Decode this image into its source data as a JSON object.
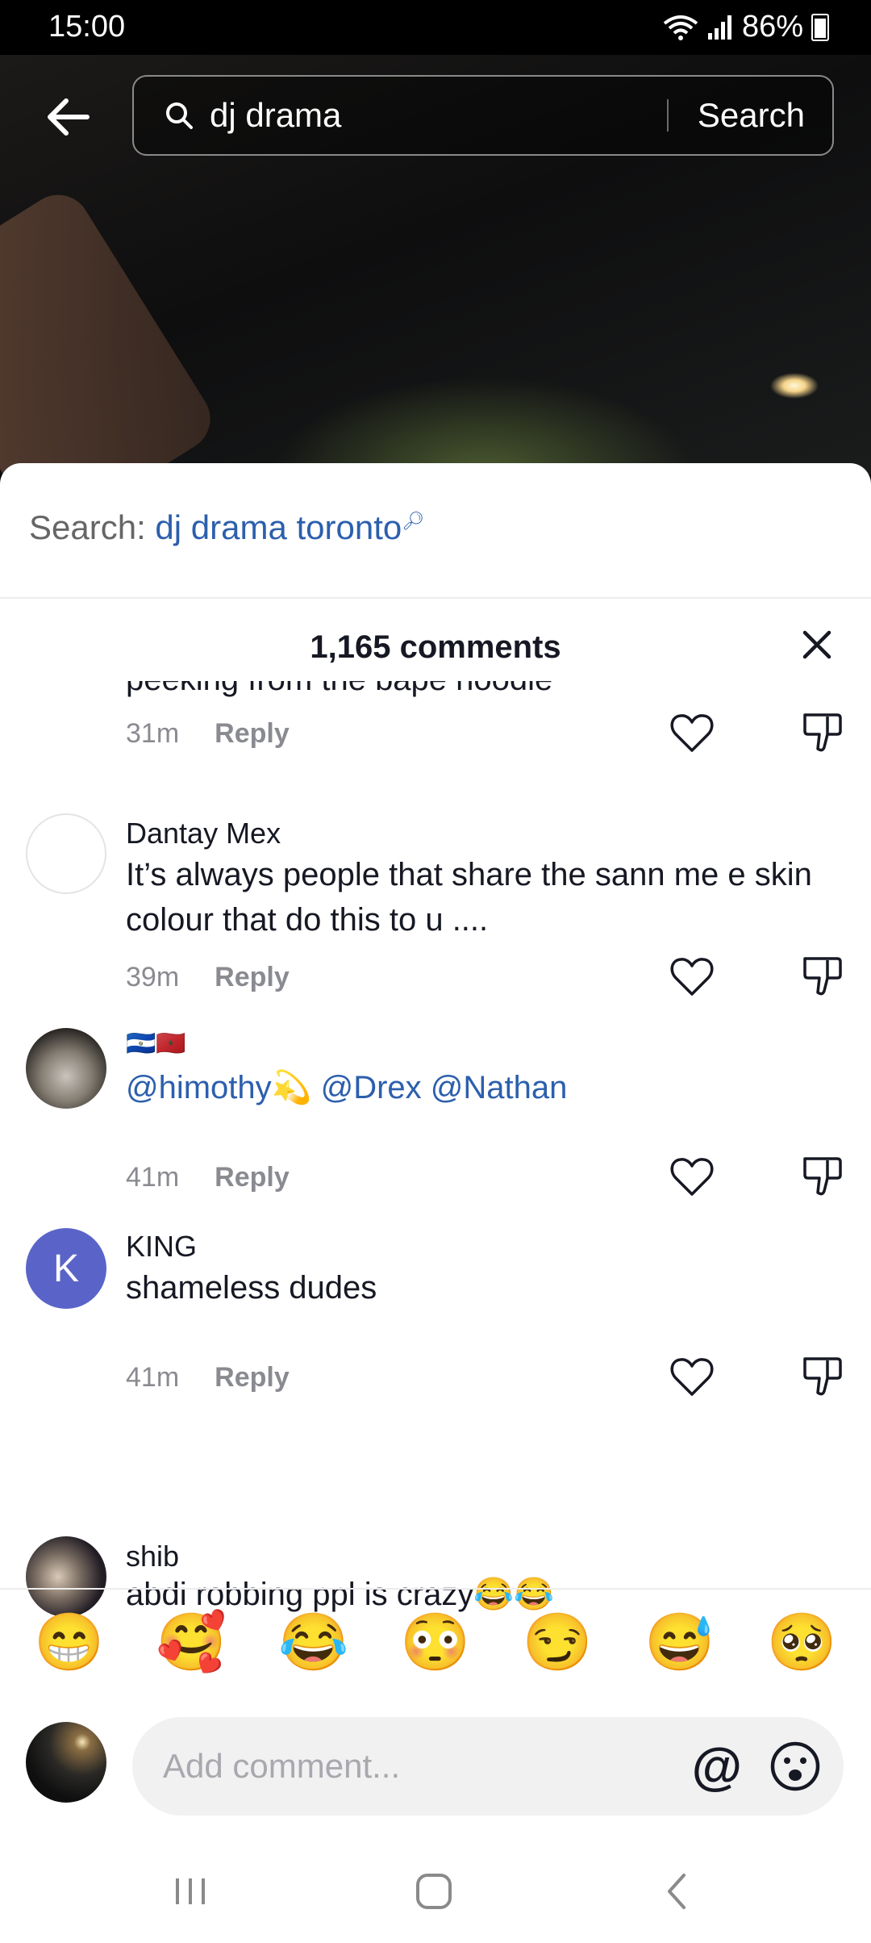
{
  "status_bar": {
    "time": "15:00",
    "battery": "86%"
  },
  "search": {
    "query": "dj drama",
    "button": "Search"
  },
  "suggestion": {
    "prefix": "Search:",
    "term": "dj drama toronto"
  },
  "comments_header": {
    "title": "1,165 comments"
  },
  "partial_comment": {
    "text": "peeking from the bape hoodie",
    "time": "31m",
    "reply": "Reply"
  },
  "comments": [
    {
      "user": "Dantay Mex",
      "text": "It’s always people that share the sann me e skin colour that do this to u ....",
      "time": "39m",
      "reply": "Reply"
    },
    {
      "user": "🇸🇻🇲🇦",
      "mentions": [
        "@himothy💫",
        "@Drex",
        "@Nathan"
      ],
      "time": "41m",
      "reply": "Reply"
    },
    {
      "user": "KING",
      "avatar_letter": "K",
      "text": "shameless dudes",
      "time": "41m",
      "reply": "Reply"
    },
    {
      "user": "shib",
      "text": "abdi robbing ppl is crazy😂😂"
    }
  ],
  "emoji_bar": [
    "😁",
    "🥰",
    "😂",
    "😳",
    "😏",
    "😅",
    "🥺"
  ],
  "composer": {
    "placeholder": "Add comment..."
  },
  "colors": {
    "link": "#2c5fad",
    "avatar_k": "#5a64c8",
    "secondary_text": "#8a8b91"
  }
}
